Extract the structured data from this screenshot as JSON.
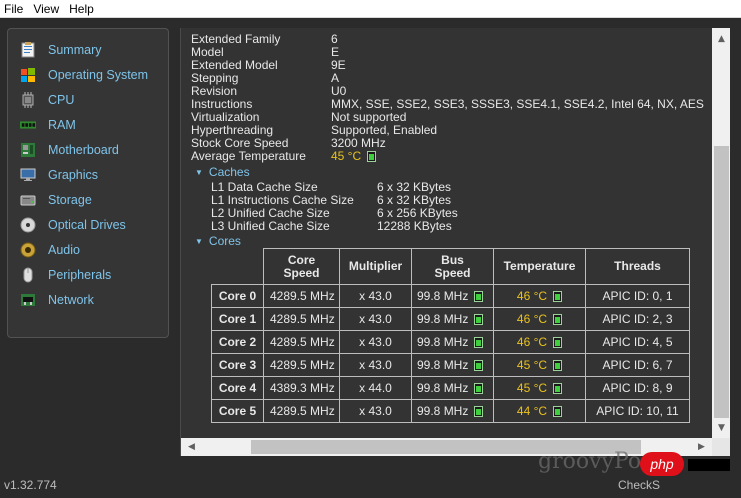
{
  "menu": [
    "File",
    "View",
    "Help"
  ],
  "sidebar": {
    "items": [
      {
        "label": "Summary",
        "icon": "summary-icon"
      },
      {
        "label": "Operating System",
        "icon": "windows-icon"
      },
      {
        "label": "CPU",
        "icon": "cpu-icon"
      },
      {
        "label": "RAM",
        "icon": "ram-icon"
      },
      {
        "label": "Motherboard",
        "icon": "motherboard-icon"
      },
      {
        "label": "Graphics",
        "icon": "monitor-icon"
      },
      {
        "label": "Storage",
        "icon": "hard-drive-icon"
      },
      {
        "label": "Optical Drives",
        "icon": "disc-icon"
      },
      {
        "label": "Audio",
        "icon": "speaker-icon"
      },
      {
        "label": "Peripherals",
        "icon": "mouse-icon"
      },
      {
        "label": "Network",
        "icon": "network-icon"
      }
    ]
  },
  "version": "v1.32.774",
  "details": [
    {
      "key": "Extended Family",
      "value": "6"
    },
    {
      "key": "Model",
      "value": "E"
    },
    {
      "key": "Extended Model",
      "value": "9E"
    },
    {
      "key": "Stepping",
      "value": "A"
    },
    {
      "key": "Revision",
      "value": "U0"
    },
    {
      "key": "Instructions",
      "value": "MMX, SSE, SSE2, SSE3, SSSE3, SSE4.1, SSE4.2, Intel 64, NX, AES"
    },
    {
      "key": "Virtualization",
      "value": "Not supported"
    },
    {
      "key": "Hyperthreading",
      "value": "Supported, Enabled"
    },
    {
      "key": "Stock Core Speed",
      "value": "3200 MHz"
    },
    {
      "key": "Average Temperature",
      "value": "45 °C"
    }
  ],
  "caches": {
    "heading": "Caches",
    "rows": [
      {
        "key": "L1 Data Cache Size",
        "value": "6 x 32 KBytes"
      },
      {
        "key": "L1 Instructions Cache Size",
        "value": "6 x 32 KBytes"
      },
      {
        "key": "L2 Unified Cache Size",
        "value": "6 x 256 KBytes"
      },
      {
        "key": "L3 Unified Cache Size",
        "value": "12288 KBytes"
      }
    ]
  },
  "cores": {
    "heading": "Cores",
    "headers": {
      "speed_1": "Core",
      "speed_2": "Speed",
      "multiplier": "Multiplier",
      "bus_1": "Bus",
      "bus_2": "Speed",
      "temperature": "Temperature",
      "threads": "Threads"
    },
    "rows": [
      {
        "name": "Core 0",
        "speed": "4289.5 MHz",
        "mult": "x 43.0",
        "bus": "99.8 MHz",
        "temp": "46 °C",
        "threads": "APIC ID: 0, 1"
      },
      {
        "name": "Core 1",
        "speed": "4289.5 MHz",
        "mult": "x 43.0",
        "bus": "99.8 MHz",
        "temp": "46 °C",
        "threads": "APIC ID: 2, 3"
      },
      {
        "name": "Core 2",
        "speed": "4289.5 MHz",
        "mult": "x 43.0",
        "bus": "99.8 MHz",
        "temp": "46 °C",
        "threads": "APIC ID: 4, 5"
      },
      {
        "name": "Core 3",
        "speed": "4289.5 MHz",
        "mult": "x 43.0",
        "bus": "99.8 MHz",
        "temp": "45 °C",
        "threads": "APIC ID: 6, 7"
      },
      {
        "name": "Core 4",
        "speed": "4389.3 MHz",
        "mult": "x 44.0",
        "bus": "99.8 MHz",
        "temp": "45 °C",
        "threads": "APIC ID: 8, 9"
      },
      {
        "name": "Core 5",
        "speed": "4289.5 MHz",
        "mult": "x 43.0",
        "bus": "99.8 MHz",
        "temp": "44 °C",
        "threads": "APIC ID: 10, 11"
      }
    ]
  },
  "watermark": {
    "text": "groovyPost",
    "badge": "php",
    "footer": "CheckS"
  },
  "colors": {
    "accent": "#7fc4ea",
    "temperature": "#e8c21f",
    "panel": "#333333"
  }
}
